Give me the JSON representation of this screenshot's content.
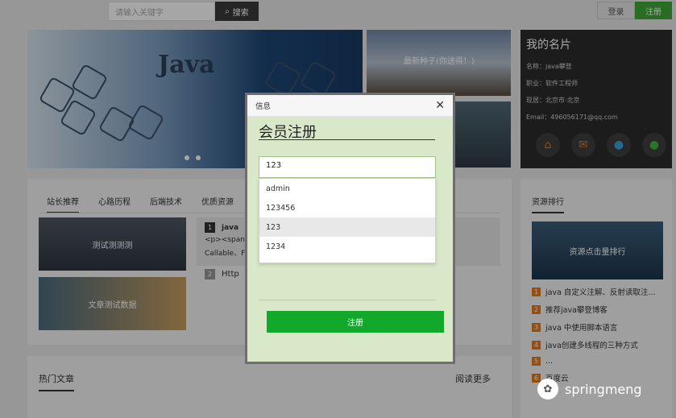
{
  "header": {
    "search_placeholder": "请输入关键字",
    "search_label": "搜索",
    "login_label": "登录",
    "register_label": "注册"
  },
  "banner": {
    "title": "Java"
  },
  "side_thumbs": {
    "top_caption": "最新种子(你送得！)"
  },
  "card": {
    "title": "我的名片",
    "rows": [
      "名称：java攀登",
      "职业：软件工程师",
      "现居：北京市·北京",
      "Email：496056171@qq.com"
    ],
    "icons": [
      "home-icon",
      "mail-icon",
      "qq-icon",
      "wechat-icon"
    ]
  },
  "main_tabs": [
    "站长推荐",
    "心路历程",
    "后端技术",
    "优质资源"
  ],
  "main_images": [
    "测试测测测",
    "文章测试数据"
  ],
  "main_list": {
    "first_title": "java",
    "first_line": "<p><span",
    "first_tail": "Callable、F",
    "second_title": "Http"
  },
  "hot": {
    "title": "热门文章",
    "more": "阅读更多"
  },
  "rank": {
    "title": "资源排行",
    "banner": "资源点击量排行",
    "items": [
      {
        "n": "1",
        "text": "java 自定义注解、反射读取注..."
      },
      {
        "n": "2",
        "text": "推荐java攀登博客"
      },
      {
        "n": "3",
        "text": "java 中使用脚本语言"
      },
      {
        "n": "4",
        "text": "java创建多线程的三种方式"
      },
      {
        "n": "5",
        "text": "..."
      },
      {
        "n": "6",
        "text": "百度云"
      }
    ]
  },
  "modal": {
    "header": "信息",
    "title": "会员注册",
    "input_value": "123",
    "suggestions": [
      "admin",
      "123456",
      "123",
      "1234"
    ],
    "submit_label": "注册"
  },
  "watermark": {
    "text": "springmeng"
  },
  "colors": {
    "accent_green": "#12a82c",
    "modal_bg": "#d9e8c8"
  }
}
